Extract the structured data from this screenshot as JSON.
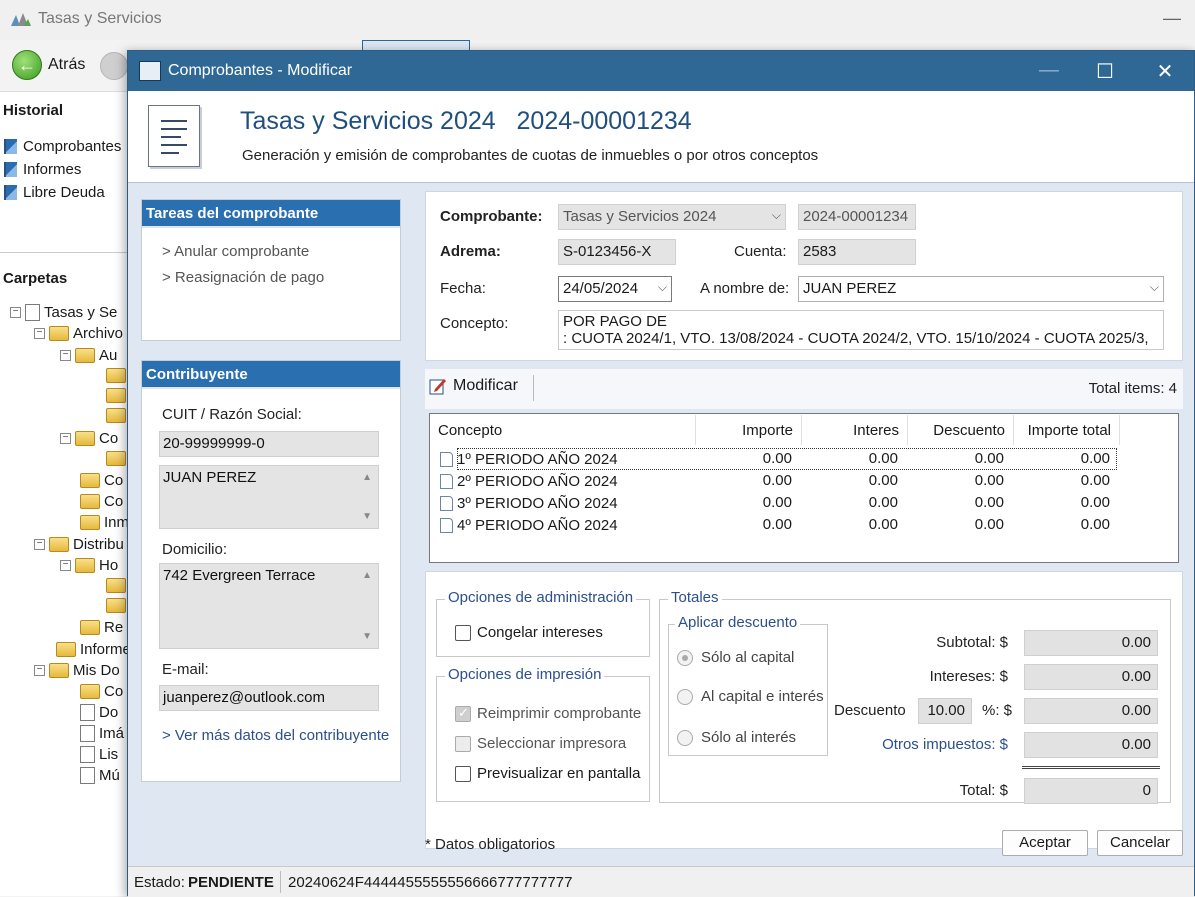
{
  "app": {
    "title": "Tasas y Servicios",
    "back_label": "Atrás",
    "historial_heading": "Historial",
    "historial_items": [
      "Comprobantes",
      "Informes",
      "Libre Deuda"
    ],
    "carpetas_heading": "Carpetas",
    "tree": [
      "Tasas y Se",
      "Archivo",
      "Au",
      "Co",
      "Co",
      "Co",
      "Inm",
      "Distribu",
      "Ho",
      "Re",
      "Informe",
      "Mis Do",
      "Co",
      "Do",
      "Imá",
      "Lis",
      "Mú"
    ]
  },
  "dialog": {
    "title": "Comprobantes - Modificar",
    "header_title": "Tasas y Servicios 2024   2024-00001234",
    "header_subtitle": "Generación y emisión de comprobantes de cuotas de inmuebles o por otros conceptos"
  },
  "tareas": {
    "heading": "Tareas del comprobante",
    "links": [
      "> Anular comprobante",
      "> Reasignación de pago"
    ]
  },
  "contribuyente": {
    "heading": "Contribuyente",
    "cuit_label": "CUIT / Razón Social:",
    "cuit": "20-99999999-0",
    "razon_social": "JUAN PEREZ",
    "domicilio_label": "Domicilio:",
    "domicilio": "742 Evergreen Terrace",
    "email_label": "E-mail:",
    "email": "juanperez@outlook.com",
    "more_link": "> Ver más datos del contribuyente"
  },
  "form": {
    "comprobante_label": "Comprobante:",
    "comprobante_tipo": "Tasas y Servicios 2024",
    "comprobante_numero": "2024-00001234",
    "adrema_label": "Adrema:",
    "adrema": "S-0123456-X",
    "cuenta_label": "Cuenta:",
    "cuenta": "2583",
    "fecha_label": "Fecha:",
    "fecha": "24/05/2024",
    "a_nombre_label": "A nombre de:",
    "a_nombre": "JUAN PEREZ",
    "concepto_label": "Concepto:",
    "concepto_line1": "POR PAGO DE",
    "concepto_line2": ": CUOTA 2024/1, VTO. 13/08/2024 - CUOTA 2024/2, VTO. 15/10/2024 - CUOTA 2025/3,"
  },
  "items_toolbar": {
    "modificar_label": "Modificar",
    "total_items": "Total items: 4"
  },
  "grid": {
    "columns": [
      "Concepto",
      "Importe",
      "Interes",
      "Descuento",
      "Importe total"
    ],
    "rows": [
      [
        "1º PERIODO AÑO 2024",
        "0.00",
        "0.00",
        "0.00",
        "0.00"
      ],
      [
        "2º PERIODO AÑO 2024",
        "0.00",
        "0.00",
        "0.00",
        "0.00"
      ],
      [
        "3º PERIODO AÑO 2024",
        "0.00",
        "0.00",
        "0.00",
        "0.00"
      ],
      [
        "4º PERIODO AÑO 2024",
        "0.00",
        "0.00",
        "0.00",
        "0.00"
      ]
    ]
  },
  "opciones_admin": {
    "title": "Opciones de administración",
    "congelar": "Congelar intereses"
  },
  "opciones_impresion": {
    "title": "Opciones de impresión",
    "reimprimir": "Reimprimir comprobante",
    "seleccionar": "Seleccionar impresora",
    "previsualizar": "Previsualizar en pantalla"
  },
  "totales": {
    "title": "Totales",
    "aplicar_title": "Aplicar descuento",
    "radio_capital": "Sólo al capital",
    "radio_ambos": "Al capital e interés",
    "radio_interes": "Sólo al interés",
    "subtotal_label": "Subtotal: $",
    "subtotal": "0.00",
    "intereses_label": "Intereses: $",
    "intereses": "0.00",
    "descuento_label": "Descuento",
    "descuento_pct": "10.00",
    "descuento_pct_label": "%: $",
    "descuento": "0.00",
    "otros_label": "Otros impuestos: $",
    "otros": "0.00",
    "total_label": "Total: $",
    "total": "0"
  },
  "footer": {
    "required_note": "* Datos obligatorios",
    "aceptar": "Aceptar",
    "cancelar": "Cancelar",
    "estado_label": "Estado:",
    "estado": "PENDIENTE",
    "codigo": "20240624F4444455555556666777777777"
  }
}
